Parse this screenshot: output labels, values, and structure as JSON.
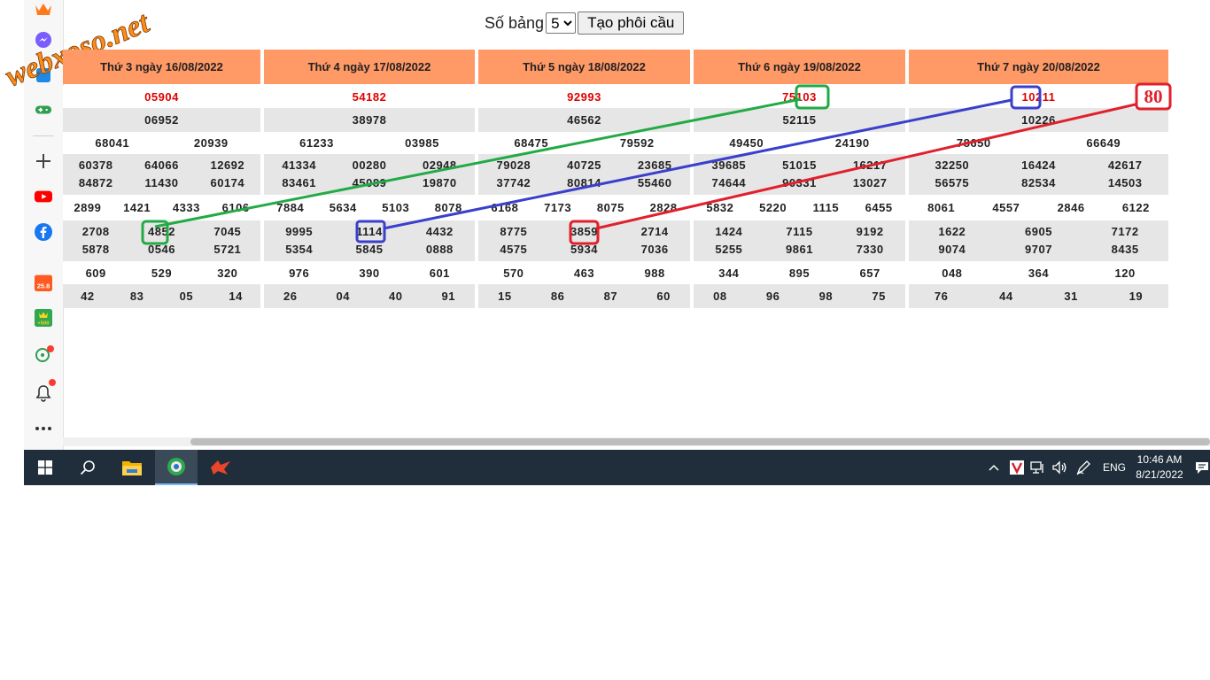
{
  "watermark": {
    "text": "webxoso.net",
    "color": "#ff8c1a"
  },
  "sidebar": {
    "icons": [
      "crown-icon",
      "messenger-icon",
      "shopping-icon",
      "game-controller-icon",
      "add-icon",
      "youtube-icon",
      "facebook-icon",
      "sale-25-8-icon",
      "crown-500-icon",
      "games-icon",
      "bell-icon",
      "more-icon"
    ],
    "sale_badge": "25.8",
    "points_badge": "+500"
  },
  "controls": {
    "label": "Số bảng",
    "select_value": "5",
    "button_label": "Tạo phôi cầu"
  },
  "colors": {
    "header": "#ff9966",
    "gray_row": "#e6e6e6",
    "special_prize": "#e00000",
    "green_line": "#22aa44",
    "blue_line": "#3a3fcc",
    "red_line": "#e0202a"
  },
  "columns": [
    {
      "date": "Thứ 3 ngày 16/08/2022",
      "g_db": "05904",
      "g1": "06952",
      "g2": [
        "68041",
        "20939"
      ],
      "g3": [
        "60378",
        "64066",
        "12692",
        "84872",
        "11430",
        "60174"
      ],
      "g4": [
        "2899",
        "1421",
        "4333",
        "6106"
      ],
      "g5": [
        "2708",
        "4852",
        "7045",
        "5878",
        "0546",
        "5721"
      ],
      "g6": [
        "609",
        "529",
        "320"
      ],
      "g7": [
        "42",
        "83",
        "05",
        "14"
      ]
    },
    {
      "date": "Thứ 4 ngày 17/08/2022",
      "g_db": "54182",
      "g1": "38978",
      "g2": [
        "61233",
        "03985"
      ],
      "g3": [
        "41334",
        "00280",
        "02948",
        "83461",
        "45089",
        "19870"
      ],
      "g4": [
        "7884",
        "5634",
        "5103",
        "8078"
      ],
      "g5": [
        "9995",
        "1114",
        "4432",
        "5354",
        "5845",
        "0888"
      ],
      "g6": [
        "976",
        "390",
        "601"
      ],
      "g7": [
        "26",
        "04",
        "40",
        "91"
      ]
    },
    {
      "date": "Thứ 5 ngày 18/08/2022",
      "g_db": "92993",
      "g1": "46562",
      "g2": [
        "68475",
        "79592"
      ],
      "g3": [
        "79028",
        "40725",
        "23685",
        "37742",
        "80814",
        "55460"
      ],
      "g4": [
        "6168",
        "7173",
        "8075",
        "2828"
      ],
      "g5": [
        "8775",
        "3859",
        "2714",
        "4575",
        "5934",
        "7036"
      ],
      "g6": [
        "570",
        "463",
        "988"
      ],
      "g7": [
        "15",
        "86",
        "87",
        "60"
      ]
    },
    {
      "date": "Thứ 6 ngày 19/08/2022",
      "g_db": "75103",
      "g1": "52115",
      "g2": [
        "49450",
        "24190"
      ],
      "g3": [
        "39685",
        "51015",
        "16217",
        "74644",
        "90331",
        "13027"
      ],
      "g4": [
        "5832",
        "5220",
        "1115",
        "6455"
      ],
      "g5": [
        "1424",
        "7115",
        "9192",
        "5255",
        "9861",
        "7330"
      ],
      "g6": [
        "344",
        "895",
        "657"
      ],
      "g7": [
        "08",
        "96",
        "98",
        "75"
      ]
    },
    {
      "date": "Thứ 7 ngày 20/08/2022",
      "g_db": "10211",
      "g1": "10226",
      "g2": [
        "78650",
        "66649"
      ],
      "g3": [
        "32250",
        "16424",
        "42617",
        "56575",
        "82534",
        "14503"
      ],
      "g4": [
        "8061",
        "4557",
        "2846",
        "6122"
      ],
      "g5": [
        "1622",
        "6905",
        "7172",
        "9074",
        "9707",
        "8435"
      ],
      "g6": [
        "048",
        "364",
        "120"
      ],
      "g7": [
        "76",
        "44",
        "31",
        "19"
      ]
    }
  ],
  "prediction_badge": "80",
  "taskbar": {
    "apps": [
      "windows-start-icon",
      "search-icon",
      "file-explorer-icon",
      "browser-icon",
      "app-icon"
    ],
    "language": "ENG",
    "time": "10:46 AM",
    "date": "8/21/2022"
  }
}
